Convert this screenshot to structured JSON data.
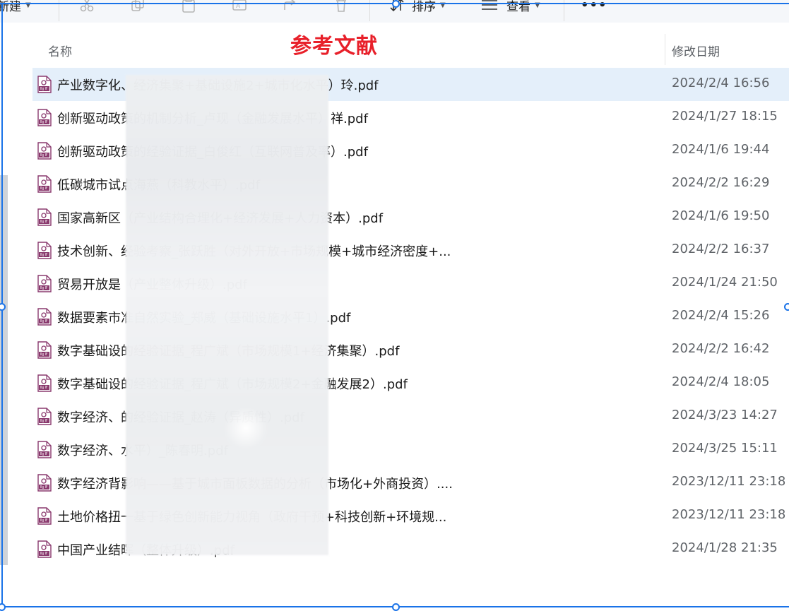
{
  "toolbar": {
    "new_label": "新建",
    "sort_label": "排序",
    "view_label": "查看",
    "more_label": "•••"
  },
  "overlay_title": "参考文献",
  "columns": {
    "name": "名称",
    "modified": "修改日期"
  },
  "files": [
    {
      "name": "产业数字化、经济集聚+基础设施2+城市化水平）玲.pdf",
      "date": "2024/2/4 16:56",
      "selected": true
    },
    {
      "name": "创新驱动政策的机制分析_卢现（金融发展水平）祥.pdf",
      "date": "2024/1/27 18:15",
      "selected": false
    },
    {
      "name": "创新驱动政策的经验证据_白俊红（互联网普及率）.pdf",
      "date": "2024/1/6 19:44",
      "selected": false
    },
    {
      "name": "低碳城市试点海燕（科教水平）.pdf",
      "date": "2024/2/2 16:29",
      "selected": false
    },
    {
      "name": "国家高新区（产业结构合理化+经济发展+人力资本）.pdf",
      "date": "2024/1/6 19:50",
      "selected": false
    },
    {
      "name": "技术创新、经验考察_张跃胜（对外开放+市场规模+城市经济密度+...",
      "date": "2024/2/2 16:37",
      "selected": false
    },
    {
      "name": "贸易开放是（产业整体升级）.pdf",
      "date": "2024/1/24 21:50",
      "selected": false
    },
    {
      "name": "数据要素市准自然实验_郑威（基础设施水平1）.pdf",
      "date": "2024/2/4 15:26",
      "selected": false
    },
    {
      "name": "数字基础设的经验证据_程广斌（市场规模1+经济集聚）.pdf",
      "date": "2024/2/2 16:42",
      "selected": false
    },
    {
      "name": "数字基础设的经验证据_程广斌（市场规模2+金融发展2）.pdf",
      "date": "2024/2/4 18:05",
      "selected": false
    },
    {
      "name": "数字经济、的经验证据_赵涛（异质性）.pdf",
      "date": "2024/3/23 14:27",
      "selected": false
    },
    {
      "name": "数字经济、水平）_陈春明.pdf",
      "date": "2024/3/25 15:11",
      "selected": false
    },
    {
      "name": "数字经济背影响——基于城市面板数据的分析（市场化+外商投资）....",
      "date": "2023/12/11 23:18",
      "selected": false
    },
    {
      "name": "土地价格扭一基于绿色创新能力视角（政府干预+科技创新+环境规...",
      "date": "2023/12/11 23:18",
      "selected": false
    },
    {
      "name": "中国产业结晖（整体升级）.pdf",
      "date": "2024/1/28 21:35",
      "selected": false
    }
  ],
  "colors": {
    "selection_bg": "#e4effa",
    "accent": "#1a73e8",
    "overlay_title": "#e8202a",
    "pdf_icon": "#8a3a6e"
  },
  "icons": {
    "file_icon": "pdf-file-icon"
  }
}
